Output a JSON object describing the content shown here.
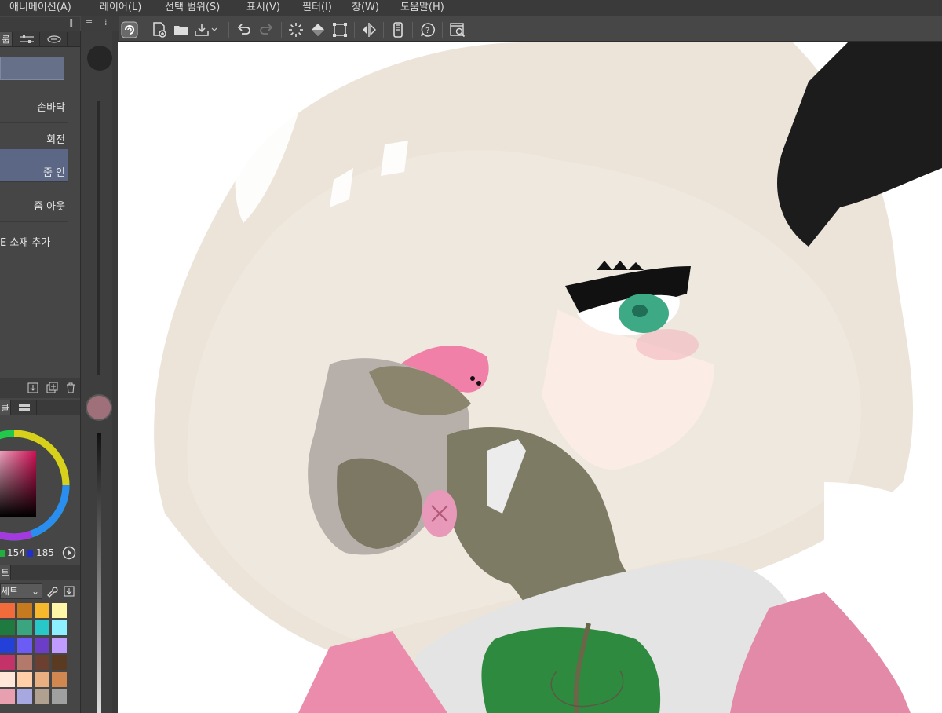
{
  "menu": {
    "items": [
      {
        "label": "애니메이션(A)"
      },
      {
        "label": "레이어(L)"
      },
      {
        "label": "선택 범위(S)"
      },
      {
        "label": "표시(V)"
      },
      {
        "label": "필터(I)"
      },
      {
        "label": "창(W)"
      },
      {
        "label": "도움말(H)"
      }
    ]
  },
  "left_panel": {
    "tab_label": "룹",
    "nav_items": [
      {
        "label": "손바닥",
        "selected": false
      },
      {
        "label": "회전",
        "selected": false
      },
      {
        "label": "줌 인",
        "selected": true
      },
      {
        "label": "줌 아웃",
        "selected": false
      },
      {
        "label": "E 소재 추가",
        "selected": false
      }
    ],
    "color_tab_label": "클",
    "color_values": {
      "g": "154",
      "b": "185"
    },
    "palette_tab_label": "트",
    "palette_set_label": "세트",
    "colors": {
      "accent": "#5b6785",
      "current_brush_color": "#a0707a",
      "menu_bg": "#3a3a3a",
      "panel_bg": "#464646"
    },
    "swatches": [
      "#f26b3a",
      "#c67a20",
      "#f6b92e",
      "#fff6a8",
      "#1f7a3f",
      "#3aa57f",
      "#28c8c8",
      "#8cf0ff",
      "#2340d8",
      "#6a5cf4",
      "#6c3ec8",
      "#c09cff",
      "#c3336a",
      "#b37a6c",
      "#6b4030",
      "#5a3a20",
      "#ffe8d8",
      "#ffd0a8",
      "#e8b080",
      "#d08850",
      "#e8a0b0",
      "#a8a8e0",
      "#b0a090",
      "#a0a0a0"
    ]
  },
  "toolbar": {
    "icons": [
      "app-logo-icon",
      "new-file-icon",
      "open-folder-icon",
      "save-icon",
      "undo-icon",
      "redo-icon",
      "loading-spinner-icon",
      "fill-icon",
      "transform-icon",
      "flip-horizontal-icon",
      "smartphone-icon",
      "help-icon",
      "search-window-icon"
    ]
  }
}
